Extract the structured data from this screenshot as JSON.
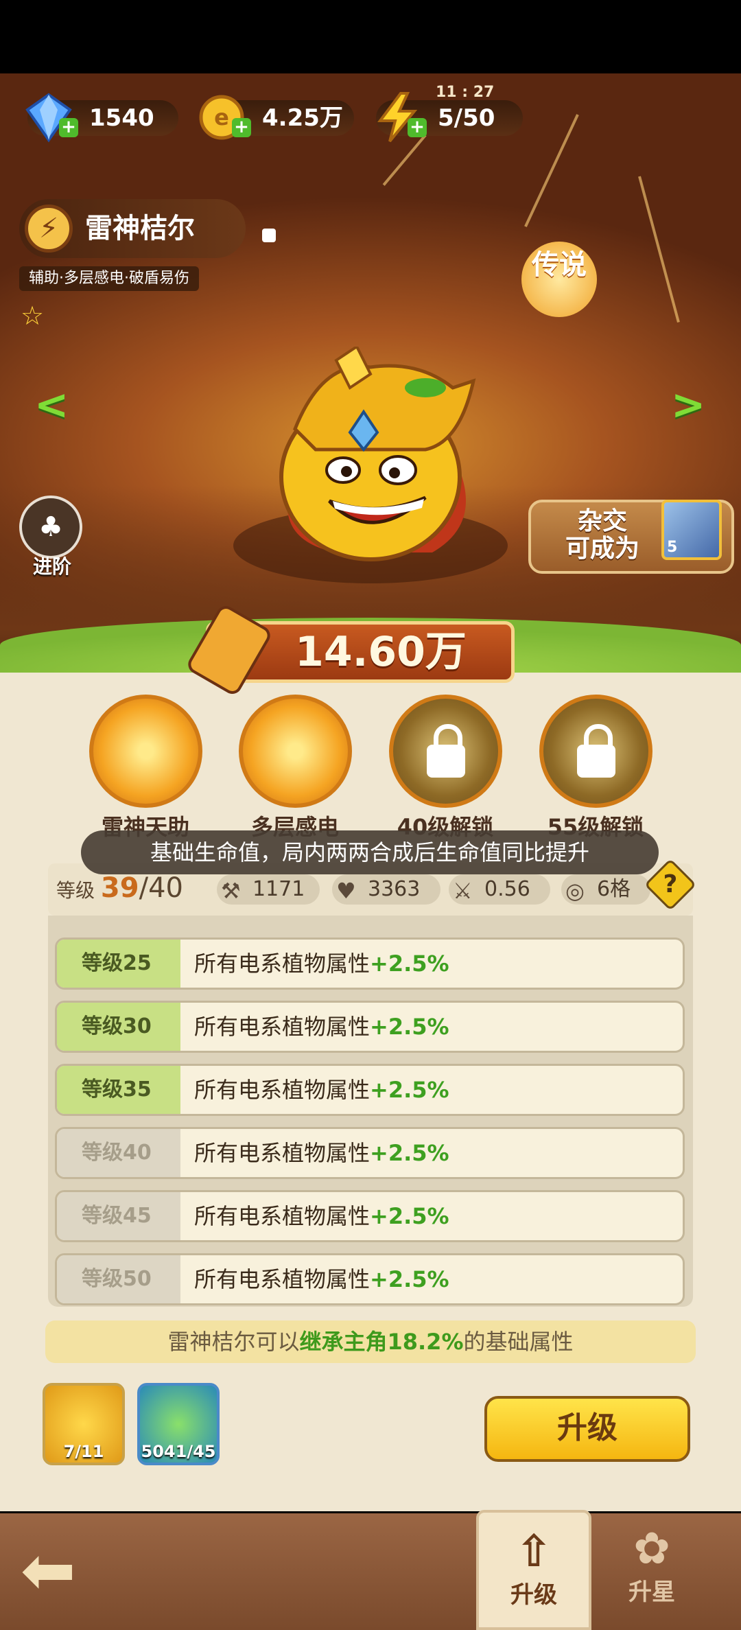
{
  "resources": {
    "gems": "1540",
    "gold": "4.25万",
    "energy": "5/50",
    "energy_timer": "11 : 27"
  },
  "hero": {
    "name": "雷神桔尔",
    "tags": "辅助·多层感电·破盾易伤",
    "rarity": "传说",
    "power": "14.60万",
    "advance_label": "进阶",
    "cross_label_1": "杂交",
    "cross_label_2": "可成为",
    "cross_card_count": "5"
  },
  "skills": [
    {
      "name": "雷神天助"
    },
    {
      "name": "多层感电"
    },
    {
      "name": "40级解锁"
    },
    {
      "name": "55级解锁"
    }
  ],
  "tooltip": "基础生命值，局内两两合成后生命值同比提升",
  "level": {
    "label": "等级",
    "current": "39",
    "max": "/40"
  },
  "stats": {
    "attack": "1171",
    "hp": "3363",
    "speed": "0.56",
    "range": "6格",
    "help": "?"
  },
  "level_bonuses": [
    {
      "level": "等级25",
      "text": "所有电系植物属性",
      "bonus": "+2.5%",
      "unlocked": true
    },
    {
      "level": "等级30",
      "text": "所有电系植物属性",
      "bonus": "+2.5%",
      "unlocked": true
    },
    {
      "level": "等级35",
      "text": "所有电系植物属性",
      "bonus": "+2.5%",
      "unlocked": true
    },
    {
      "level": "等级40",
      "text": "所有电系植物属性",
      "bonus": "+2.5%",
      "unlocked": false
    },
    {
      "level": "等级45",
      "text": "所有电系植物属性",
      "bonus": "+2.5%",
      "unlocked": false
    },
    {
      "level": "等级50",
      "text": "所有电系植物属性",
      "bonus": "+2.5%",
      "unlocked": false
    }
  ],
  "inherit": {
    "prefix": "雷神桔尔可以",
    "highlight": "继承主角18.2%",
    "suffix": "的基础属性"
  },
  "materials": [
    {
      "count": "7/11"
    },
    {
      "count": "5041/45"
    }
  ],
  "upgrade_button": "升级",
  "tabs": {
    "upgrade": "升级",
    "star": "升星"
  },
  "colors": {
    "accent_green": "#3ea020",
    "gold": "#f5b610",
    "panel": "#f0e7d2"
  }
}
